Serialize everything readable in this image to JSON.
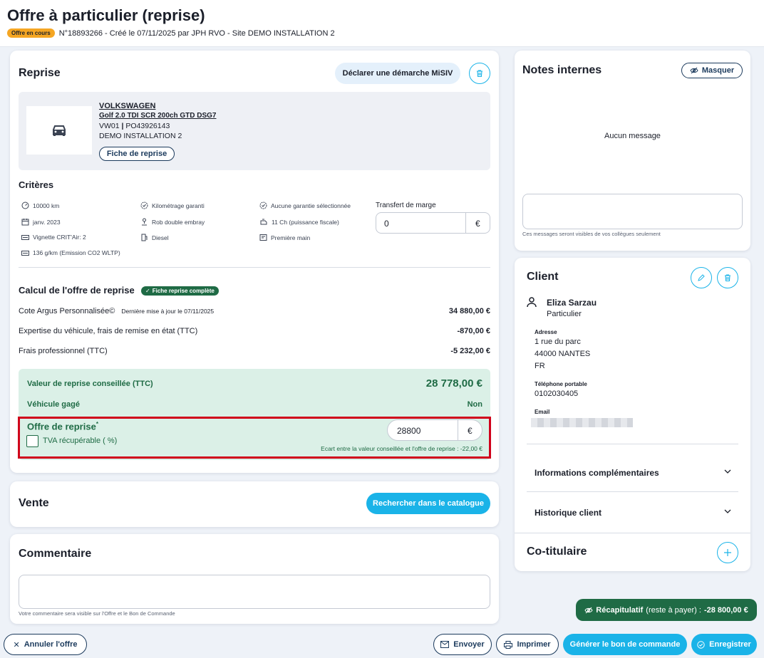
{
  "header": {
    "title": "Offre à particulier (reprise)",
    "status_badge": "Offre en cours",
    "subtitle": "N°18893266 - Créé le 07/11/2025 par JPH RVO - Site DEMO INSTALLATION 2"
  },
  "reprise": {
    "title": "Reprise",
    "misiv_button": "Déclarer une démarche MiSIV",
    "vehicle": {
      "brand": "VOLKSWAGEN",
      "model": "Golf 2.0 TDI SCR 200ch GTD DSG7",
      "ref_a": "VW01",
      "ref_sep": "|",
      "ref_b": "PO43926143",
      "site": "DEMO INSTALLATION 2",
      "sheet_button": "Fiche de reprise"
    },
    "criteria_title": "Critères",
    "criteria": [
      {
        "icon": "gauge-icon",
        "text": "10000 km"
      },
      {
        "icon": "badge-check-icon",
        "text": "Kilométrage garanti"
      },
      {
        "icon": "badge-check-icon",
        "text": "Aucune garantie sélectionnée"
      },
      {
        "icon": "calendar-icon",
        "text": "janv. 2023"
      },
      {
        "icon": "gearshift-icon",
        "text": "Rob double embray"
      },
      {
        "icon": "engine-icon",
        "text": "11 Ch (puissance fiscale)"
      },
      {
        "icon": "sticker-icon",
        "text": "Vignette CRIT'Air: 2"
      },
      {
        "icon": "fuel-icon",
        "text": "Diesel"
      },
      {
        "icon": "document-icon",
        "text": "Première main"
      },
      {
        "icon": "co2-icon",
        "text": "136 g/km (Emission CO2 WLTP)"
      }
    ],
    "margin_transfer": {
      "label": "Transfert de marge",
      "value": "0",
      "unit": "€"
    }
  },
  "calcul": {
    "title": "Calcul de l'offre de reprise",
    "badge": "Fiche reprise complète",
    "rows": [
      {
        "label": "Cote Argus Personnalisée©",
        "note": "Dernière mise à jour le 07/11/2025",
        "value": "34 880,00 €"
      },
      {
        "label": "Expertise du véhicule, frais de remise en état (TTC)",
        "note": "",
        "value": "-870,00 €"
      },
      {
        "label": "Frais professionnel (TTC)",
        "note": "",
        "value": "-5 232,00 €"
      }
    ],
    "advised_label": "Valeur de reprise conseillée (TTC)",
    "advised_value": "28 778,00 €",
    "pledged_label": "Véhicule gagé",
    "pledged_value": "Non",
    "offer_label": "Offre de reprise",
    "offer_required": "*",
    "offer_value": "28800",
    "offer_unit": "€",
    "vat_label": "TVA récupérable ( %)",
    "gap_text": "Ecart entre la valeur conseillée et l'offre de reprise : -22,00 €"
  },
  "vente": {
    "title": "Vente",
    "catalog_button": "Rechercher dans le catalogue"
  },
  "commentaire": {
    "title": "Commentaire",
    "value": "",
    "hint": "Votre commentaire sera visible sur l'Offre et le Bon de Commande"
  },
  "notes": {
    "title": "Notes internes",
    "hide_button": "Masquer",
    "empty": "Aucun message",
    "input_value": "",
    "hint": "Ces messages seront visibles de vos collègues seulement"
  },
  "client": {
    "title": "Client",
    "name": "Eliza Sarzau",
    "type": "Particulier",
    "address_label": "Adresse",
    "address_lines": [
      "1 rue du parc",
      "44000 NANTES",
      "FR"
    ],
    "phone_label": "Téléphone portable",
    "phone": "0102030405",
    "email_label": "Email",
    "sections": [
      "Informations complémentaires",
      "Historique client"
    ]
  },
  "cotitulaire": {
    "title": "Co-titulaire"
  },
  "summary": {
    "label": "Récapitulatif",
    "detail": "(reste à payer) :",
    "amount": "-28 800,00 €"
  },
  "footer": {
    "cancel": "Annuler l'offre",
    "send": "Envoyer",
    "print": "Imprimer",
    "generate": "Générer le bon de commande",
    "save": "Enregistrer"
  },
  "colors": {
    "accent": "#1ab3e8",
    "green": "#1f6b45",
    "orange": "#f5a623",
    "alert_red": "#d0021b"
  }
}
